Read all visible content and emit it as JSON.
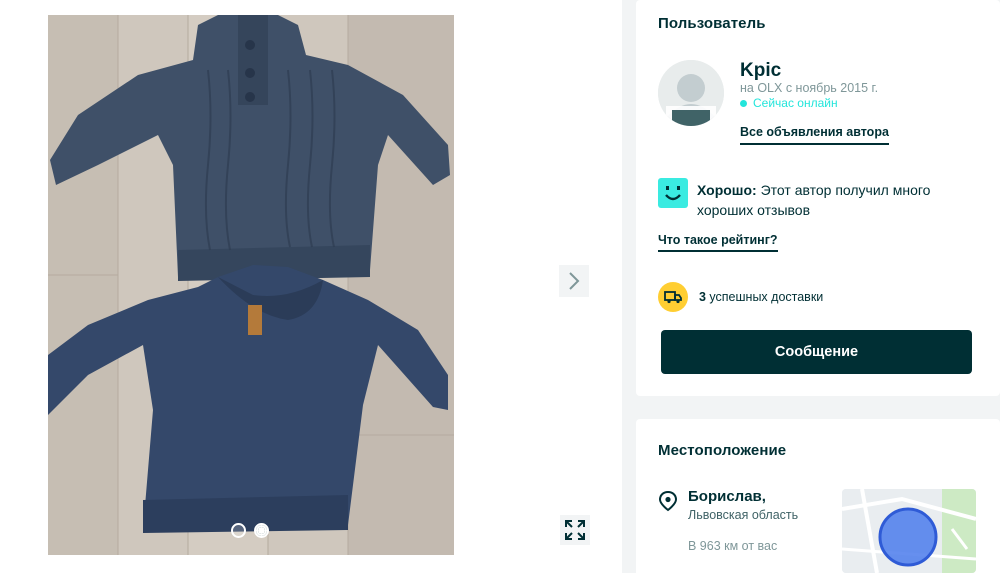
{
  "gallery": {
    "image_alt": "photo-of-two-knitted-sweaters",
    "dots": [
      {
        "active": false
      },
      {
        "active": true
      }
    ],
    "next_icon": "chevron-right-icon",
    "fullscreen_icon": "expand-icon"
  },
  "user": {
    "section_title": "Пользователь",
    "name": "Kpic",
    "since": "на OLX с ноябрь 2015 г.",
    "online": "Сейчас онлайн",
    "all_ads_link": "Все объявления автора",
    "rating_label": "Хорошо:",
    "rating_text": " Этот автор получил много хороших отзывов",
    "rating_link": "Что такое рейтинг?",
    "delivery_count": "3",
    "delivery_text": " успешных доставки",
    "message_button": "Сообщение"
  },
  "location": {
    "section_title": "Местоположение",
    "city": "Борислав,",
    "region": "Львовская область",
    "distance": "В 963 км от вас"
  },
  "colors": {
    "primary": "#002f34",
    "online": "#23e5db",
    "rating_badge": "#3aebe1",
    "delivery_badge": "#ffce32",
    "panel_bg": "#f2f4f5"
  }
}
